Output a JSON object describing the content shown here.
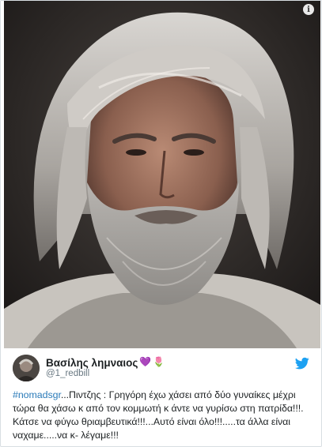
{
  "tweet": {
    "display_name": "Βασίλης λημναιος",
    "emoji": [
      "💜",
      "🌷"
    ],
    "handle": "@1_redbill",
    "hashtag": "#nomadsgr",
    "text": "...Πιντζης : Γρηγόρη έχω χάσει από δύο γυναίκες μέχρι τώρα θα χάσω κ από τον κομμωτή κ άντε να γυρίσω στη πατρίδα!!!. Κάτσε να φύγω θριαμβευτικά!!!...Αυτό είναι όλο!!!.....τα άλλα είναι ναχαμε.....να κ- λέγαμε!!!"
  },
  "icons": {
    "info": "info-icon",
    "twitter": "twitter-bird-icon"
  },
  "colors": {
    "hashtag": "#2b7bb9",
    "twitter_blue": "#1da1f2",
    "text": "#1c2022",
    "handle": "#697882"
  }
}
